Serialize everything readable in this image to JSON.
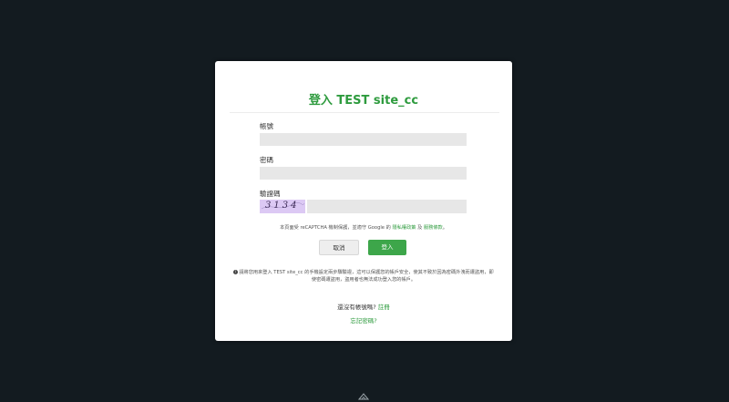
{
  "dialog": {
    "title": "登入 TEST site_cc"
  },
  "form": {
    "username_label": "帳號",
    "username_value": "",
    "password_label": "密碼",
    "password_value": "",
    "captcha_label": "驗證碼",
    "captcha_text": "3134",
    "captcha_value": ""
  },
  "recaptcha": {
    "text_before": "本頁面受 reCAPTCHA 機制保護，並適守 Google 的",
    "privacy_link": "隱私權政策",
    "and": "及",
    "terms_link": "服務條款",
    "end": "。"
  },
  "buttons": {
    "cancel": "取消",
    "login": "登入"
  },
  "notice": {
    "icon": "❶",
    "text": "請將您用來登入 TEST site_cc 的手機設定兩步驟驗證，這可以保護您的帳戶安全，使其不致於因為密碼外洩而遭盜用，即使密碼遭盜用，盜用者也無法成功登入您的帳戶。"
  },
  "signup": {
    "question": "還沒有帳號嗎?",
    "link": "註冊"
  },
  "forgot": {
    "link": "忘記密碼?"
  },
  "colors": {
    "background": "#131b20",
    "accent": "#2e9b3e",
    "button_green": "#3da64a",
    "input_bg": "#e7e7e7",
    "captcha_bg": "#dcc9f4"
  }
}
